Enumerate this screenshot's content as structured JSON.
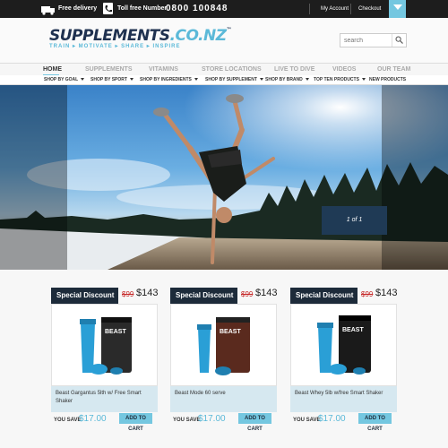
{
  "topbar": {
    "delivery": "Free delivery",
    "tollfree_label": "Toll free Number",
    "tollfree_number": "0800 100848",
    "my_account": "My Account",
    "checkout": "Checkout"
  },
  "logo": {
    "main": "SUPPLEMENTS",
    "tld": ".CO.NZ",
    "tm": "™",
    "tagline": "TRAIN ▸ MOTIVATE ▸ SHARE ▸ INSPIRE"
  },
  "search": {
    "placeholder": "search"
  },
  "mainnav": [
    "HOME",
    "SUPPLEMENTS",
    "VITAMINS",
    "STORE LOCATIONS",
    "LIVE TO DIVE",
    "VIDEOS",
    "OUR TEAM"
  ],
  "subnav": [
    "SHOP BY GOAL",
    "SHOP BY SPORT",
    "SHOP BY INGREDIENTS",
    "SHOP BY SUPPLEMENT",
    "SHOP BY BRAND",
    "TOP TEN PRODUCTS",
    "NEW PRODUCTS"
  ],
  "hero": {
    "indicator": "1 of 1"
  },
  "products": [
    {
      "badge": "Special Discount",
      "old_price": "$99",
      "new_price": "$143",
      "name": "Beast Gargantus 5lth w/ Free Smart Shaker",
      "save_label": "YOU SAVE",
      "save_value": "$17.00",
      "cta": "ADD TO CART",
      "tub_color": "#2a2a2a",
      "tub_label": "BEAST"
    },
    {
      "badge": "Special Discount",
      "old_price": "$99",
      "new_price": "$143",
      "name": "Beast Mode 60 serve",
      "save_label": "YOU SAVE",
      "save_value": "$17.00",
      "cta": "ADD TO CART",
      "tub_color": "#5a2a1e",
      "tub_label": "BEAST"
    },
    {
      "badge": "Special Discount",
      "old_price": "$99",
      "new_price": "$143",
      "name": "Beast Whey 5lb w/free Smart Shaker",
      "save_label": "YOU SAVE",
      "save_value": "$17.00",
      "cta": "ADD TO CART",
      "tub_color": "#1a1a1a",
      "tub_label": "BEAST"
    }
  ],
  "colors": {
    "accent": "#74c7e0",
    "navy": "#1d2b3a",
    "sale_red": "#c62828"
  }
}
